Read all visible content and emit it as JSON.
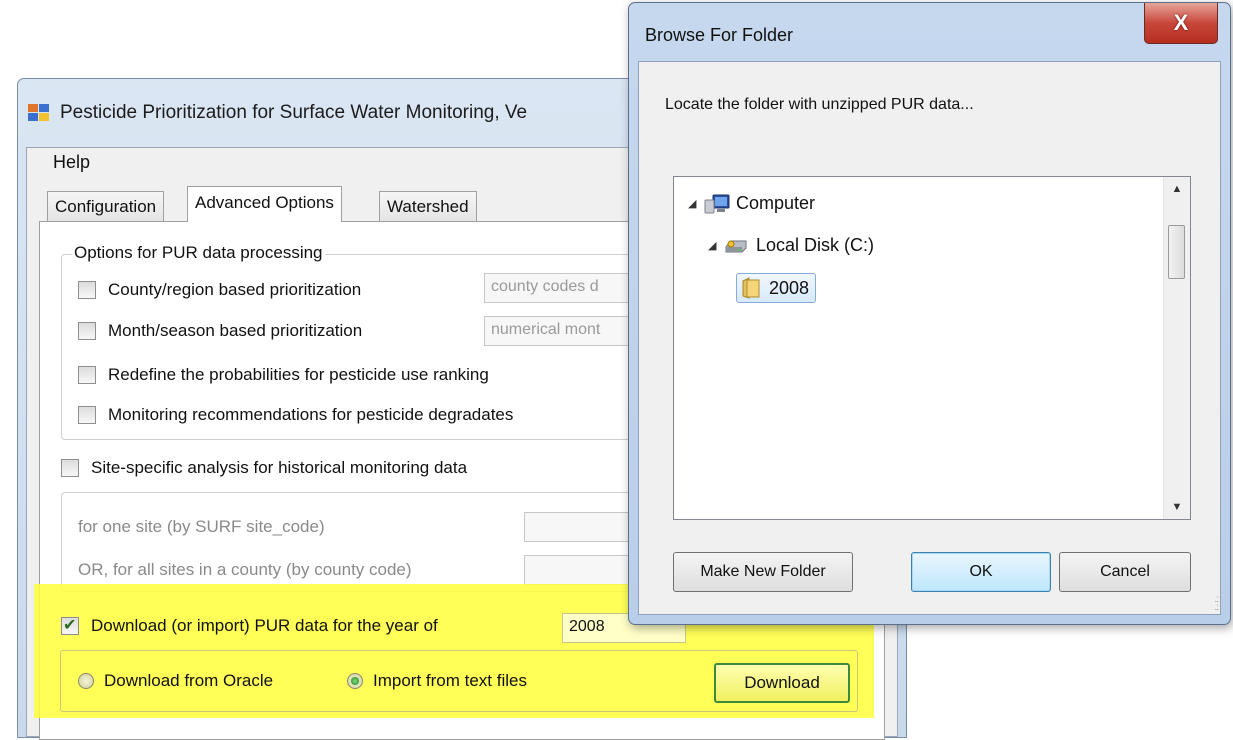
{
  "main_window": {
    "title": "Pesticide Prioritization for Surface Water Monitoring, Ve",
    "menu_help": "Help",
    "tabs": [
      {
        "label": "Configuration",
        "active": false
      },
      {
        "label": "Advanced Options",
        "active": true
      },
      {
        "label": "Watershed",
        "active": false
      }
    ],
    "pur_group": {
      "title": "Options for PUR data processing",
      "county_label": "County/region based prioritization",
      "county_placeholder": "county codes d",
      "month_label": "Month/season based prioritization",
      "month_placeholder": "numerical mont",
      "redefine_label": "Redefine the probabilities for pesticide use ranking",
      "degradates_label": "Monitoring recommendations for pesticide degradates"
    },
    "site_specific": {
      "label": "Site-specific analysis for historical monitoring data",
      "one_site_label": "for one site (by SURF site_code)",
      "all_sites_label": "OR, for all sites in a county (by county code)"
    },
    "download": {
      "checkbox_label": "Download (or import) PUR data for the year of",
      "checked": true,
      "year_value": "2008",
      "radio_oracle": "Download from Oracle",
      "radio_text": "Import from text files",
      "selected_radio": "text",
      "button_label": "Download"
    }
  },
  "dialog": {
    "title": "Browse For Folder",
    "close_symbol": "X",
    "message": "Locate the folder with unzipped PUR data...",
    "tree": {
      "computer": "Computer",
      "disk": "Local Disk (C:)",
      "folder": "2008"
    },
    "buttons": {
      "new_folder": "Make New Folder",
      "ok": "OK",
      "cancel": "Cancel"
    }
  },
  "colors": {
    "highlight": "#ffff3a",
    "close_button": "#c8473a",
    "selection": "#d7e9fb"
  },
  "icons": [
    "app-icon",
    "computer-icon",
    "local-disk-icon",
    "folder-icon",
    "close-icon"
  ]
}
